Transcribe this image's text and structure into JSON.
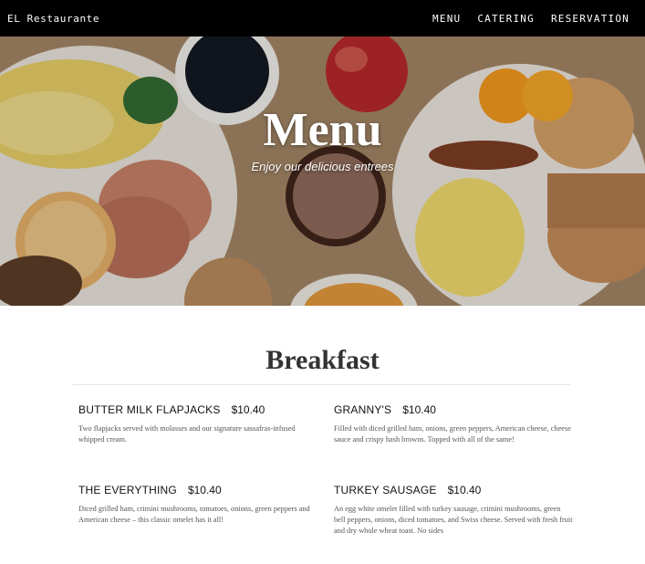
{
  "navbar": {
    "brand": "EL Restaurante",
    "links": [
      "MENU",
      "CATERING",
      "RESERVATION"
    ]
  },
  "hero": {
    "title": "Menu",
    "subtitle": "Enjoy our delicious entrees"
  },
  "section": {
    "title": "Breakfast",
    "items": [
      {
        "name": "BUTTER MILK FLAPJACKS",
        "price": "$10.40",
        "description": "Two flapjacks served with molasses and our signature sassafras-infused whipped cream."
      },
      {
        "name": "GRANNY'S",
        "price": "$10.40",
        "description": "Filled with diced grilled ham, onions, green peppers, American cheese, cheese sauce and crispy hash browns. Topped with all of the same!"
      },
      {
        "name": "THE EVERYTHING",
        "price": "$10.40",
        "description": "Diced grilled ham, crimini mushrooms, tomatoes, onions, green peppers and American cheese – this classic omelet has it all!"
      },
      {
        "name": "TURKEY SAUSAGE",
        "price": "$10.40",
        "description": "An egg white omelet filled with turkey sausage, crimini mushrooms, green bell peppers, onions, diced tomatoes, and Swiss cheese. Served with fresh fruit and dry whole wheat toast. No sides"
      }
    ]
  },
  "colors": {
    "navbar_bg": "#000000",
    "hero_text": "#ffffff",
    "title_text": "#333333"
  }
}
